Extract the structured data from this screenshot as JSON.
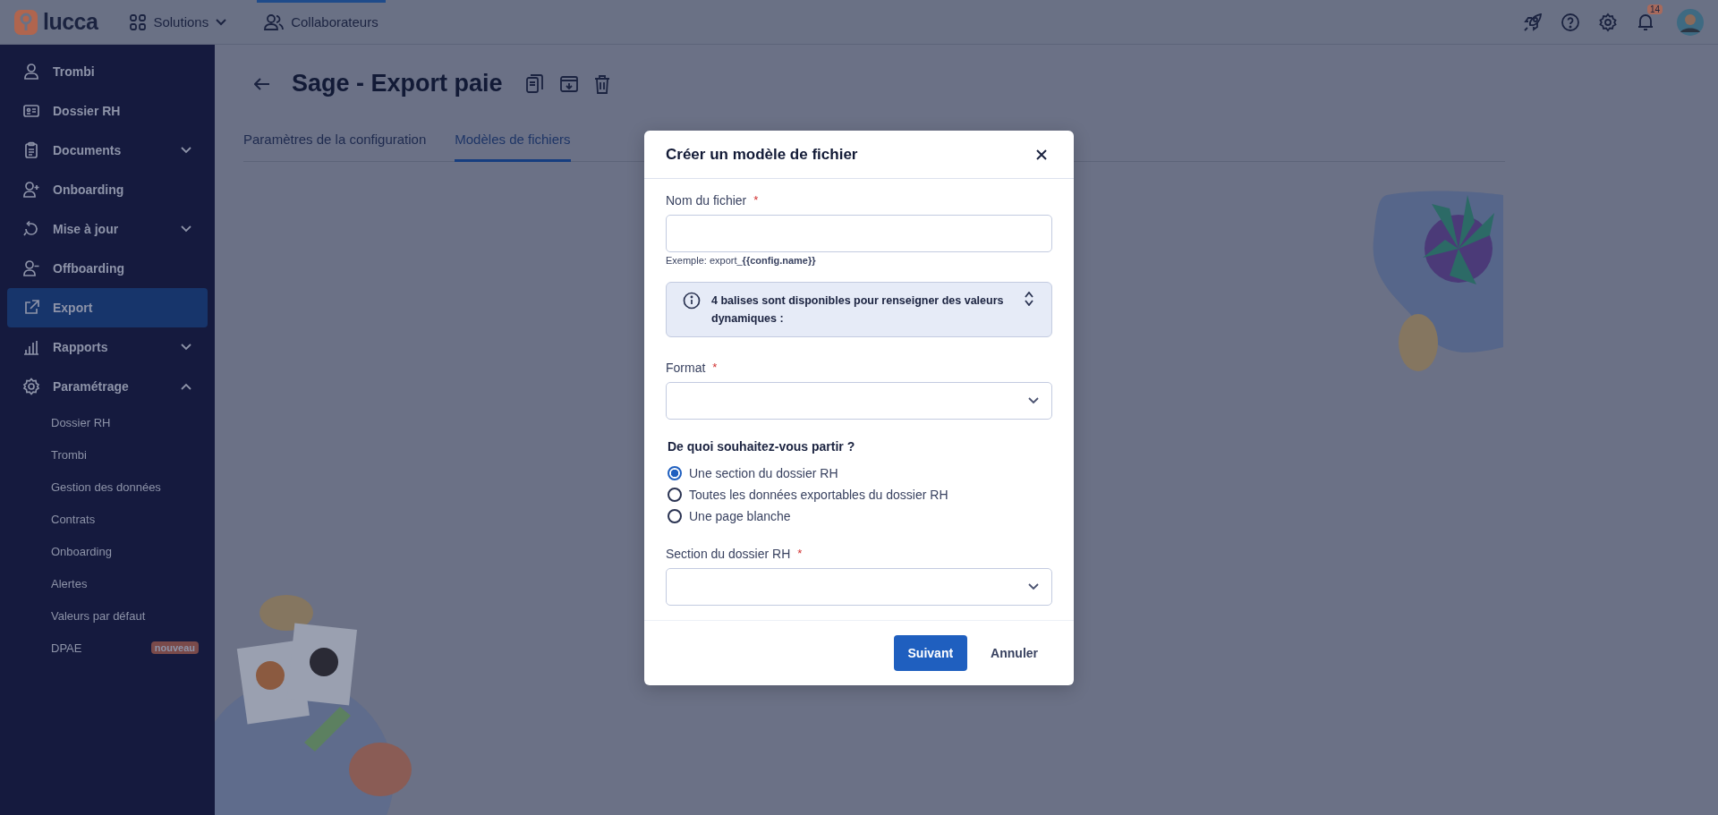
{
  "topbar": {
    "logo": "lucca",
    "nav": [
      {
        "label": "Solutions",
        "kind": "dropdown",
        "selected": false
      },
      {
        "label": "Collaborateurs",
        "kind": "link",
        "selected": true
      }
    ],
    "notifications": "14"
  },
  "sidebar": {
    "items": [
      {
        "label": "Trombi",
        "selected": false
      },
      {
        "label": "Dossier RH",
        "selected": false
      },
      {
        "label": "Documents",
        "selected": false,
        "expanded": false
      },
      {
        "label": "Onboarding",
        "selected": false
      },
      {
        "label": "Mise à jour",
        "selected": false,
        "expanded": false
      },
      {
        "label": "Offboarding",
        "selected": false
      },
      {
        "label": "Export",
        "selected": true
      },
      {
        "label": "Rapports",
        "selected": false,
        "expanded": false
      },
      {
        "label": "Paramétrage",
        "selected": false,
        "expanded": true,
        "children": [
          {
            "label": "Dossier RH"
          },
          {
            "label": "Trombi"
          },
          {
            "label": "Gestion des données"
          },
          {
            "label": "Contrats"
          },
          {
            "label": "Onboarding"
          },
          {
            "label": "Alertes"
          },
          {
            "label": "Valeurs par défaut"
          },
          {
            "label": "DPAE",
            "badge": "nouveau"
          }
        ]
      }
    ]
  },
  "page": {
    "title": "Sage - Export paie",
    "tabs": [
      {
        "label": "Paramètres de la configuration",
        "selected": false
      },
      {
        "label": "Modèles de fichiers",
        "selected": true
      }
    ]
  },
  "dialog": {
    "title": "Créer un modèle de fichier",
    "name_field": {
      "label": "Nom du fichier",
      "required_mark": "*",
      "hint": "Exemple: export_**{{config.name}}**"
    },
    "info": {
      "text": "4 balises sont disponibles pour renseigner des valeurs dynamiques :",
      "expanded": false
    },
    "format_field": {
      "label": "Format",
      "required_mark": "*"
    },
    "start": {
      "question": "De quoi souhaitez-vous partir ?",
      "options": [
        {
          "label": "Une section du dossier RH",
          "selected": true
        },
        {
          "label": "Toutes les données exportables du dossier RH",
          "selected": false
        },
        {
          "label": "Une page blanche",
          "selected": false
        }
      ]
    },
    "section_field": {
      "label": "Section du dossier RH",
      "required_mark": "*"
    },
    "buttons": [
      {
        "label": "Suivant",
        "kind": "primary"
      },
      {
        "label": "Annuler",
        "kind": "secondary"
      }
    ]
  }
}
